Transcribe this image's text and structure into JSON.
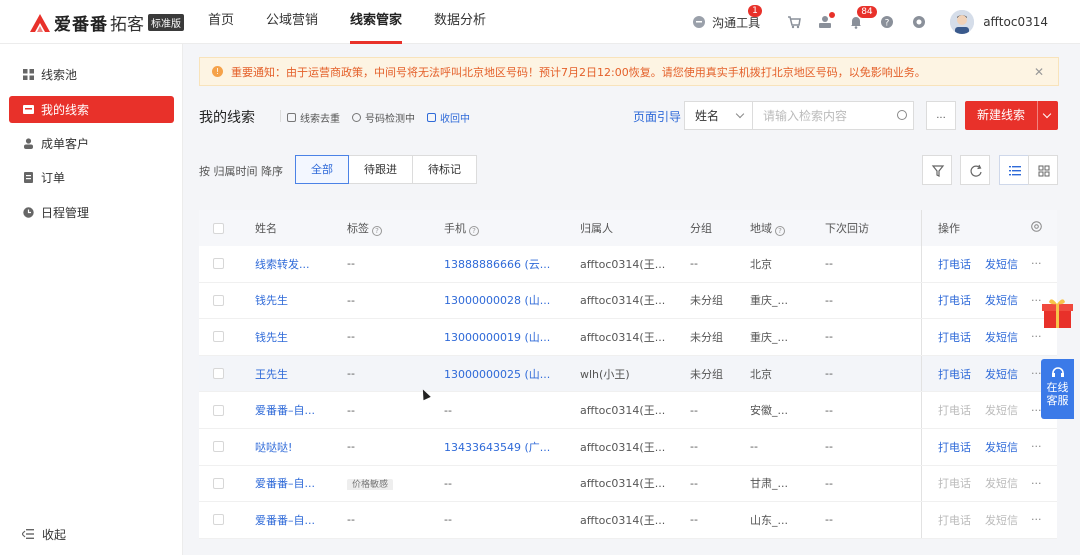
{
  "brand": {
    "name": "爱番番",
    "product": "拓客",
    "edition": "标准版"
  },
  "nav": {
    "items": [
      "首页",
      "公域营销",
      "线索管家",
      "数据分析"
    ],
    "active_index": 2
  },
  "topbar": {
    "comm_tool": "沟通工具",
    "comm_badge": "1",
    "notify_badge": "84",
    "username": "afftoc0314"
  },
  "sidebar": {
    "items": [
      {
        "label": "线索池",
        "icon": "grid-icon"
      },
      {
        "label": "我的线索",
        "icon": "folder-icon",
        "active": true
      },
      {
        "label": "成单客户",
        "icon": "person-icon"
      },
      {
        "label": "订单",
        "icon": "order-icon"
      },
      {
        "label": "日程管理",
        "icon": "clock-icon"
      }
    ],
    "collapse_label": "收起"
  },
  "notice": {
    "text": "重要通知：由于运营商政策，中间号将无法呼叫北京地区号码！预计7月2日12:00恢复。请您使用真实手机拨打北京地区号码，以免影响业务。"
  },
  "toolbar": {
    "title": "我的线索",
    "links": [
      "线索去重",
      "号码检测中",
      "收回中"
    ],
    "page_guide": "页面引导",
    "search_field": "姓名",
    "search_placeholder": "请输入检索内容",
    "more_label": "...",
    "new_label": "新建线索"
  },
  "filter": {
    "sort_label": "按 归属时间 降序",
    "tabs": [
      "全部",
      "待跟进",
      "待标记"
    ],
    "active_tab": 0
  },
  "table": {
    "headers": {
      "name": "姓名",
      "tag": "标签",
      "phone": "手机",
      "owner": "归属人",
      "group": "分组",
      "region": "地域",
      "next": "下次回访",
      "ops": "操作"
    },
    "op_call": "打电话",
    "op_sms": "发短信",
    "op_more": "···",
    "rows": [
      {
        "name": "线索转发...",
        "tag": "--",
        "phone": "13888886666 (云...",
        "owner": "afftoc0314(王...",
        "group": "--",
        "region": "北京",
        "next": "--",
        "ops_enabled": true
      },
      {
        "name": "钱先生",
        "tag": "--",
        "phone": "13000000028 (山...",
        "owner": "afftoc0314(王...",
        "group": "未分组",
        "region": "重庆_...",
        "next": "--",
        "ops_enabled": true
      },
      {
        "name": "钱先生",
        "tag": "--",
        "phone": "13000000019 (山...",
        "owner": "afftoc0314(王...",
        "group": "未分组",
        "region": "重庆_...",
        "next": "--",
        "ops_enabled": true
      },
      {
        "name": "王先生",
        "tag": "--",
        "phone": "13000000025 (山...",
        "owner": "wlh(小王)",
        "group": "未分组",
        "region": "北京",
        "next": "--",
        "ops_enabled": true
      },
      {
        "name": "爱番番–自...",
        "tag": "--",
        "phone": "--",
        "owner": "afftoc0314(王...",
        "group": "--",
        "region": "安徽_...",
        "next": "--",
        "ops_enabled": false
      },
      {
        "name": "哒哒哒!",
        "tag": "--",
        "phone": "13433643549 (广...",
        "owner": "afftoc0314(王...",
        "group": "--",
        "region": "--",
        "next": "--",
        "ops_enabled": true
      },
      {
        "name": "爱番番–自...",
        "tag": "价格敏感",
        "phone": "--",
        "owner": "afftoc0314(王...",
        "group": "--",
        "region": "甘肃_...",
        "next": "--",
        "ops_enabled": false
      },
      {
        "name": "爱番番–自...",
        "tag": "--",
        "phone": "--",
        "owner": "afftoc0314(王...",
        "group": "--",
        "region": "山东_...",
        "next": "--",
        "ops_enabled": false
      }
    ]
  },
  "floaters": {
    "service_label_1": "在线",
    "service_label_2": "客服"
  },
  "colors": {
    "brand_red": "#e8312a",
    "link_blue": "#2f6ad8"
  }
}
